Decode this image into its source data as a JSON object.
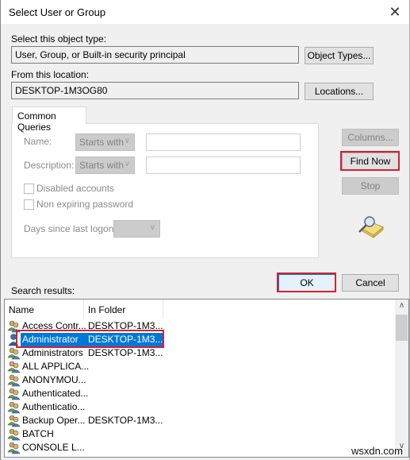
{
  "window": {
    "title": "Select User or Group",
    "close_icon": "close-icon"
  },
  "object_type": {
    "label": "Select this object type:",
    "value": "User, Group, or Built-in security principal",
    "button": "Object Types..."
  },
  "location": {
    "label": "From this location:",
    "value": "DESKTOP-1M3OG80",
    "button": "Locations..."
  },
  "common_queries": {
    "tab_label": "Common Queries",
    "name_label": "Name:",
    "name_mode": "Starts with",
    "name_value": "",
    "description_label": "Description:",
    "description_mode": "Starts with",
    "description_value": "",
    "disabled_accounts_label": "Disabled accounts",
    "disabled_accounts_checked": false,
    "non_expiring_label": "Non expiring password",
    "non_expiring_checked": false,
    "days_label": "Days since last logon:",
    "days_value": ""
  },
  "side_buttons": {
    "columns": "Columns...",
    "find_now": "Find Now",
    "stop": "Stop"
  },
  "dialog_buttons": {
    "ok": "OK",
    "cancel": "Cancel"
  },
  "results": {
    "label": "Search results:",
    "columns": [
      "Name",
      "In Folder"
    ],
    "rows": [
      {
        "name": "Access Contr...",
        "folder": "DESKTOP-1M3...",
        "icon": "group-icon",
        "selected": false
      },
      {
        "name": "Administrator",
        "folder": "DESKTOP-1M3...",
        "icon": "user-icon",
        "selected": true
      },
      {
        "name": "Administrators",
        "folder": "DESKTOP-1M3...",
        "icon": "group-icon",
        "selected": false
      },
      {
        "name": "ALL APPLICA...",
        "folder": "",
        "icon": "group-icon",
        "selected": false
      },
      {
        "name": "ANONYMOU...",
        "folder": "",
        "icon": "group-icon",
        "selected": false
      },
      {
        "name": "Authenticated...",
        "folder": "",
        "icon": "group-icon",
        "selected": false
      },
      {
        "name": "Authenticatio...",
        "folder": "",
        "icon": "group-icon",
        "selected": false
      },
      {
        "name": "Backup Oper...",
        "folder": "DESKTOP-1M3...",
        "icon": "group-icon",
        "selected": false
      },
      {
        "name": "BATCH",
        "folder": "",
        "icon": "group-icon",
        "selected": false
      },
      {
        "name": "CONSOLE L...",
        "folder": "",
        "icon": "group-icon",
        "selected": false
      }
    ]
  },
  "watermark": "wsxdn.com",
  "colors": {
    "highlight": "#d6202e",
    "selection": "#0078d7"
  }
}
